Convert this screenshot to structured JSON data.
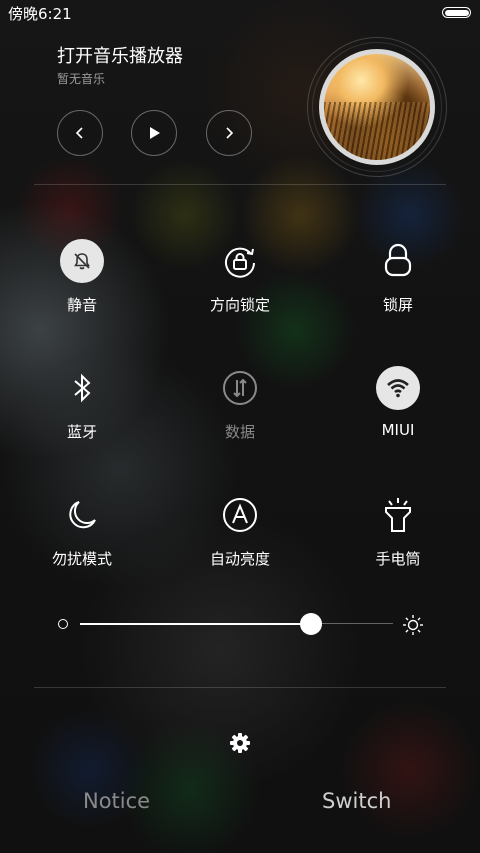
{
  "status_bar": {
    "time": "傍晚6:21",
    "battery_icon": "battery-full-icon"
  },
  "music": {
    "title": "打开音乐播放器",
    "subtitle": "暂无音乐",
    "controls": [
      "previous-icon",
      "play-icon",
      "next-icon"
    ]
  },
  "toggles": [
    {
      "label": "静音",
      "icon": "bell-muted-icon",
      "active": true
    },
    {
      "label": "方向锁定",
      "icon": "rotation-lock-icon",
      "active": false
    },
    {
      "label": "锁屏",
      "icon": "lock-icon",
      "active": false
    },
    {
      "label": "蓝牙",
      "icon": "bluetooth-icon",
      "active": false
    },
    {
      "label": "数据",
      "icon": "mobile-data-icon",
      "active": false,
      "disabled": true
    },
    {
      "label": "MIUI",
      "icon": "wifi-icon",
      "active": true
    },
    {
      "label": "勿扰模式",
      "icon": "moon-icon",
      "active": false
    },
    {
      "label": "自动亮度",
      "icon": "auto-brightness-icon",
      "active": false
    },
    {
      "label": "手电筒",
      "icon": "flashlight-icon",
      "active": false
    }
  ],
  "brightness": {
    "level": 0.74
  },
  "tabs": {
    "notice": "Notice",
    "switch": "Switch",
    "selected": "Switch"
  },
  "colors": {
    "active_circle": "#e6e6e6",
    "dim_text": "#8a8a8a"
  }
}
